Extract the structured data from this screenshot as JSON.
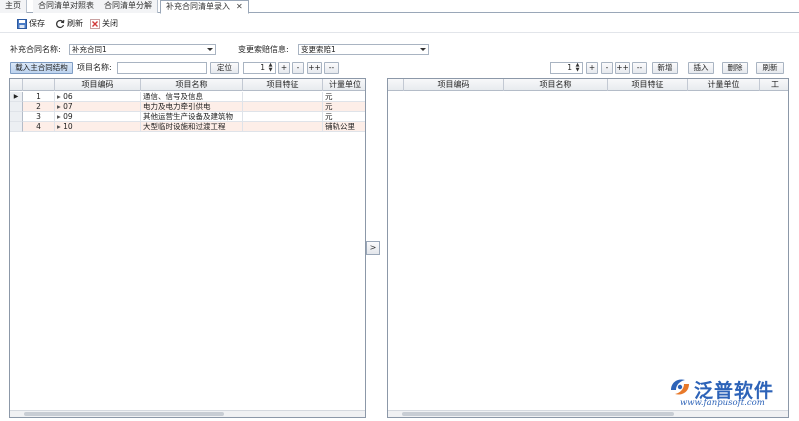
{
  "tabs": [
    {
      "label": "主页",
      "active": false
    },
    {
      "label": "合同清单对照表",
      "active": false
    },
    {
      "label": "合同清单分解",
      "active": false
    },
    {
      "label": "补充合同清单录入",
      "active": true
    }
  ],
  "toolbar": {
    "save_label": "保存",
    "refresh_label": "刷新",
    "close_label": "关闭"
  },
  "filters": {
    "contract_label": "补充合同名称:",
    "contract_value": "补充合同1",
    "change_label": "变更索赔信息:",
    "change_value": "变更索赔1"
  },
  "left_tools": {
    "load_button": "载入主合同结构",
    "item_name_label": "项目名称:",
    "item_name_value": "",
    "locate_button": "定位",
    "level_value": "1",
    "plus": "+",
    "minus": "-",
    "plusplus": "++",
    "minusminus": "--"
  },
  "right_tools": {
    "level_value": "1",
    "plus": "+",
    "minus": "-",
    "plusplus": "++",
    "minusminus": "--",
    "add_button": "新增",
    "insert_button": "插入",
    "delete_button": "删除",
    "refresh_button": "刷新"
  },
  "left_grid": {
    "columns": [
      "项目编码",
      "项目名称",
      "项目特征",
      "计量单位"
    ],
    "rows": [
      {
        "index": "1",
        "code": "06",
        "name": "通信、信号及信息",
        "feature": "",
        "unit": "元",
        "current": true
      },
      {
        "index": "2",
        "code": "07",
        "name": "电力及电力牵引供电",
        "feature": "",
        "unit": "元",
        "current": false
      },
      {
        "index": "3",
        "code": "09",
        "name": "其他运营生产设备及建筑物",
        "feature": "",
        "unit": "元",
        "current": false
      },
      {
        "index": "4",
        "code": "10",
        "name": "大型临时设施和过渡工程",
        "feature": "",
        "unit": "铺轨公里",
        "current": false
      }
    ]
  },
  "right_grid": {
    "columns": [
      "项目编码",
      "项目名称",
      "项目特征",
      "计量单位",
      "工"
    ]
  },
  "splitter_glyph": ">",
  "logo": {
    "name": "泛普软件",
    "url": "www.fanpusoft.com",
    "color": "#2d63b8"
  }
}
